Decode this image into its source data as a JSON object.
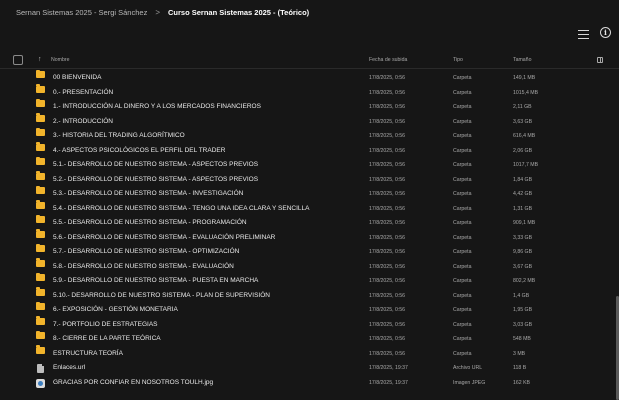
{
  "breadcrumb": {
    "parent": "Sernan Sistemas 2025 - Sergi Sánchez",
    "separator": ">",
    "current": "Curso Sernan Sistemas 2025 - (Teórico)"
  },
  "toolbar": {
    "list_icon": "list-view-icon",
    "info_icon": "info-icon",
    "info_glyph": "i"
  },
  "columns": {
    "sort_arrow": "↑",
    "name": "Nombre",
    "date": "Fecha de subida",
    "type": "Tipo",
    "size": "Tamaño"
  },
  "colors": {
    "background": "#161616",
    "folder": "#f2b42b",
    "text": "#eaeaea",
    "muted": "#a8a8a8"
  },
  "rows": [
    {
      "icon": "folder-icon",
      "name": "00 BIENVENIDA",
      "date": "17/8/2025, 0:56",
      "type": "Carpeta",
      "size": "149,1 MB"
    },
    {
      "icon": "folder-icon",
      "name": "0.- PRESENTACIÓN",
      "date": "17/8/2025, 0:56",
      "type": "Carpeta",
      "size": "1015,4 MB"
    },
    {
      "icon": "folder-icon",
      "name": "1.- INTRODUCCIÓN AL DINERO Y A LOS MERCADOS FINANCIEROS",
      "date": "17/8/2025, 0:56",
      "type": "Carpeta",
      "size": "2,11 GB"
    },
    {
      "icon": "folder-icon",
      "name": "2.- INTRODUCCIÓN",
      "date": "17/8/2025, 0:56",
      "type": "Carpeta",
      "size": "3,63 GB"
    },
    {
      "icon": "folder-icon",
      "name": "3.- HISTORIA DEL TRADING ALGORÍTMICO",
      "date": "17/8/2025, 0:56",
      "type": "Carpeta",
      "size": "616,4 MB"
    },
    {
      "icon": "folder-icon",
      "name": "4.- ASPECTOS PSICOLÓGICOS EL PERFIL DEL TRADER",
      "date": "17/8/2025, 0:56",
      "type": "Carpeta",
      "size": "2,06 GB"
    },
    {
      "icon": "folder-icon",
      "name": "5.1.- DESARROLLO DE NUESTRO SISTEMA - ASPECTOS PREVIOS",
      "date": "17/8/2025, 0:56",
      "type": "Carpeta",
      "size": "1017,7 MB"
    },
    {
      "icon": "folder-icon",
      "name": "5.2.- DESARROLLO DE NUESTRO SISTEMA - ASPECTOS PREVIOS",
      "date": "17/8/2025, 0:56",
      "type": "Carpeta",
      "size": "1,84 GB"
    },
    {
      "icon": "folder-icon",
      "name": "5.3.- DESARROLLO DE NUESTRO SISTEMA - INVESTIGACIÓN",
      "date": "17/8/2025, 0:56",
      "type": "Carpeta",
      "size": "4,42 GB"
    },
    {
      "icon": "folder-icon",
      "name": "5.4.- DESARROLLO DE NUESTRO SISTEMA - TENGO UNA IDEA CLARA Y SENCILLA",
      "date": "17/8/2025, 0:56",
      "type": "Carpeta",
      "size": "1,31 GB"
    },
    {
      "icon": "folder-icon",
      "name": "5.5.- DESARROLLO DE NUESTRO SISTEMA - PROGRAMACIÓN",
      "date": "17/8/2025, 0:56",
      "type": "Carpeta",
      "size": "909,1 MB"
    },
    {
      "icon": "folder-icon",
      "name": "5.6.- DESARROLLO DE NUESTRO SISTEMA - EVALUACIÓN PRELIMINAR",
      "date": "17/8/2025, 0:56",
      "type": "Carpeta",
      "size": "3,33 GB"
    },
    {
      "icon": "folder-icon",
      "name": "5.7.- DESARROLLO DE NUESTRO SISTEMA - OPTIMIZACIÓN",
      "date": "17/8/2025, 0:56",
      "type": "Carpeta",
      "size": "9,86 GB"
    },
    {
      "icon": "folder-icon",
      "name": "5.8.- DESARROLLO DE NUESTRO SISTEMA - EVALUACIÓN",
      "date": "17/8/2025, 0:56",
      "type": "Carpeta",
      "size": "3,67 GB"
    },
    {
      "icon": "folder-icon",
      "name": "5.9.- DESARROLLO DE NUESTRO SISTEMA - PUESTA EN MARCHA",
      "date": "17/8/2025, 0:56",
      "type": "Carpeta",
      "size": "802,2 MB"
    },
    {
      "icon": "folder-icon",
      "name": "5.10.- DESARROLLO DE NUESTRO SISTEMA - PLAN DE SUPERVISIÓN",
      "date": "17/8/2025, 0:56",
      "type": "Carpeta",
      "size": "1,4 GB"
    },
    {
      "icon": "folder-icon",
      "name": "6.- EXPOSICIÓN - GESTIÓN MONETARIA",
      "date": "17/8/2025, 0:56",
      "type": "Carpeta",
      "size": "1,95 GB"
    },
    {
      "icon": "folder-icon",
      "name": "7.- PORTFOLIO DE ESTRATEGIAS",
      "date": "17/8/2025, 0:56",
      "type": "Carpeta",
      "size": "3,03 GB"
    },
    {
      "icon": "folder-icon",
      "name": "8.- CIERRE DE LA PARTE TEÓRICA",
      "date": "17/8/2025, 0:56",
      "type": "Carpeta",
      "size": "548 MB"
    },
    {
      "icon": "folder-icon",
      "name": "ESTRUCTURA TEORÍA",
      "date": "17/8/2025, 0:56",
      "type": "Carpeta",
      "size": "3 MB"
    },
    {
      "icon": "document-icon",
      "name": "Enlaces.url",
      "date": "17/8/2025, 19:37",
      "type": "Archivo URL",
      "size": "118 B"
    },
    {
      "icon": "image-file-icon",
      "name": "GRACIAS POR CONFIAR EN NOSOTROS TOULH.jpg",
      "date": "17/8/2025, 19:37",
      "type": "Imagen JPEG",
      "size": "162 KB"
    }
  ]
}
